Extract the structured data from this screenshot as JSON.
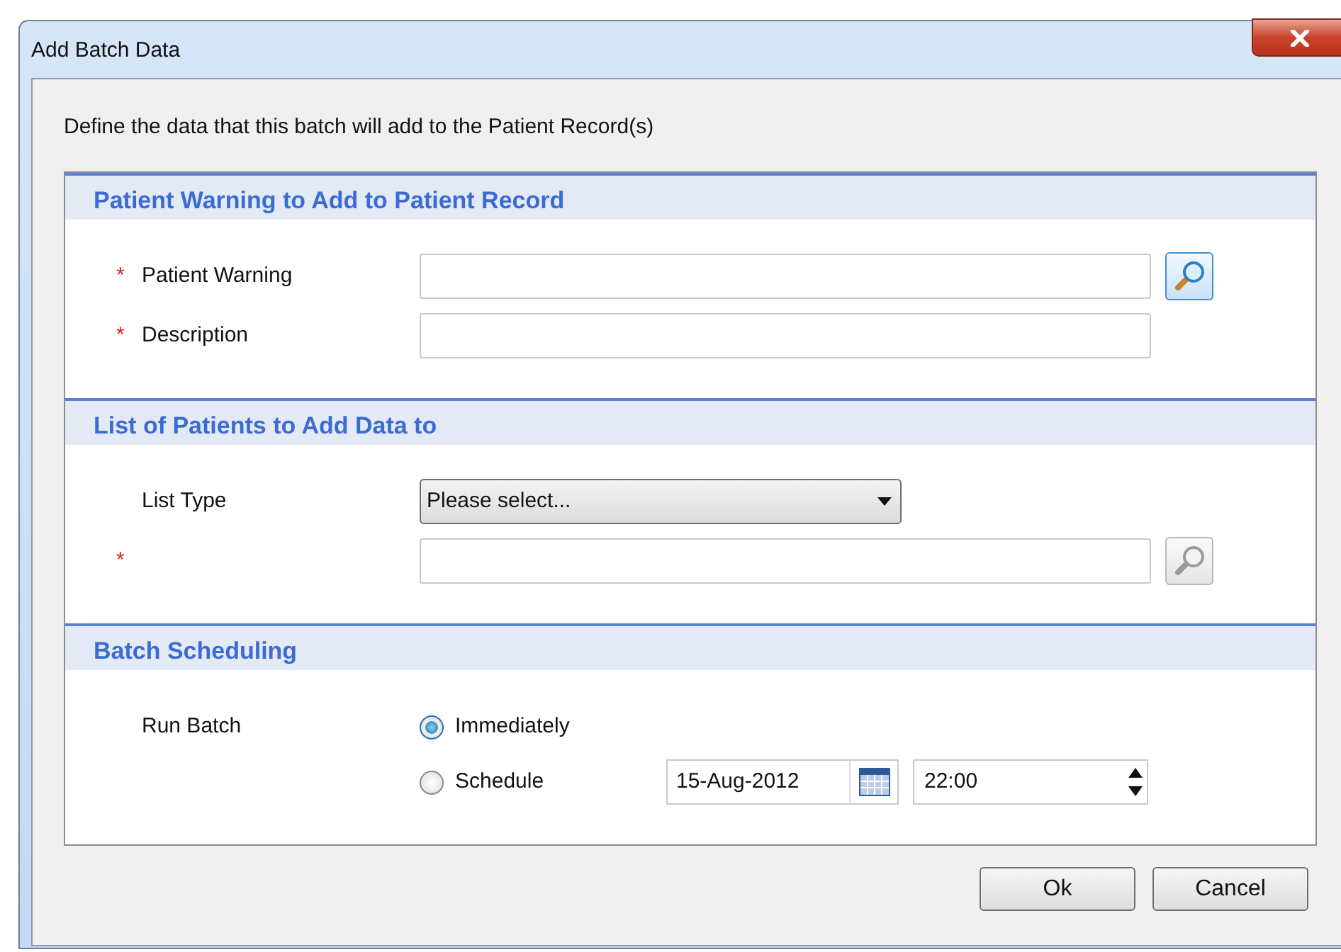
{
  "window": {
    "title": "Add Batch Data"
  },
  "intro": "Define the data that this batch will add to the Patient Record(s)",
  "sections": [
    {
      "title": "Patient Warning to Add to Patient Record",
      "rows": [
        {
          "kind": "lookup",
          "marker": "*",
          "label": "Patient Warning",
          "lookup_enabled": true
        },
        {
          "kind": "text",
          "marker": "*",
          "label": "Description"
        }
      ]
    },
    {
      "title": "List of Patients to Add Data to",
      "rows": [
        {
          "kind": "select",
          "label": "List Type",
          "value": "Please select..."
        },
        {
          "kind": "lookup",
          "marker": "*",
          "lookup_enabled": false
        }
      ]
    },
    {
      "title": "Batch Scheduling",
      "rows": [
        {
          "kind": "radio",
          "label": "Run Batch",
          "options": [
            {
              "label": "Immediately",
              "selected": true
            },
            {
              "label": "Schedule",
              "selected": false,
              "date": "15-Aug-2012",
              "time": "22:00"
            }
          ]
        }
      ]
    }
  ],
  "buttons": [
    "Ok",
    "Cancel"
  ]
}
